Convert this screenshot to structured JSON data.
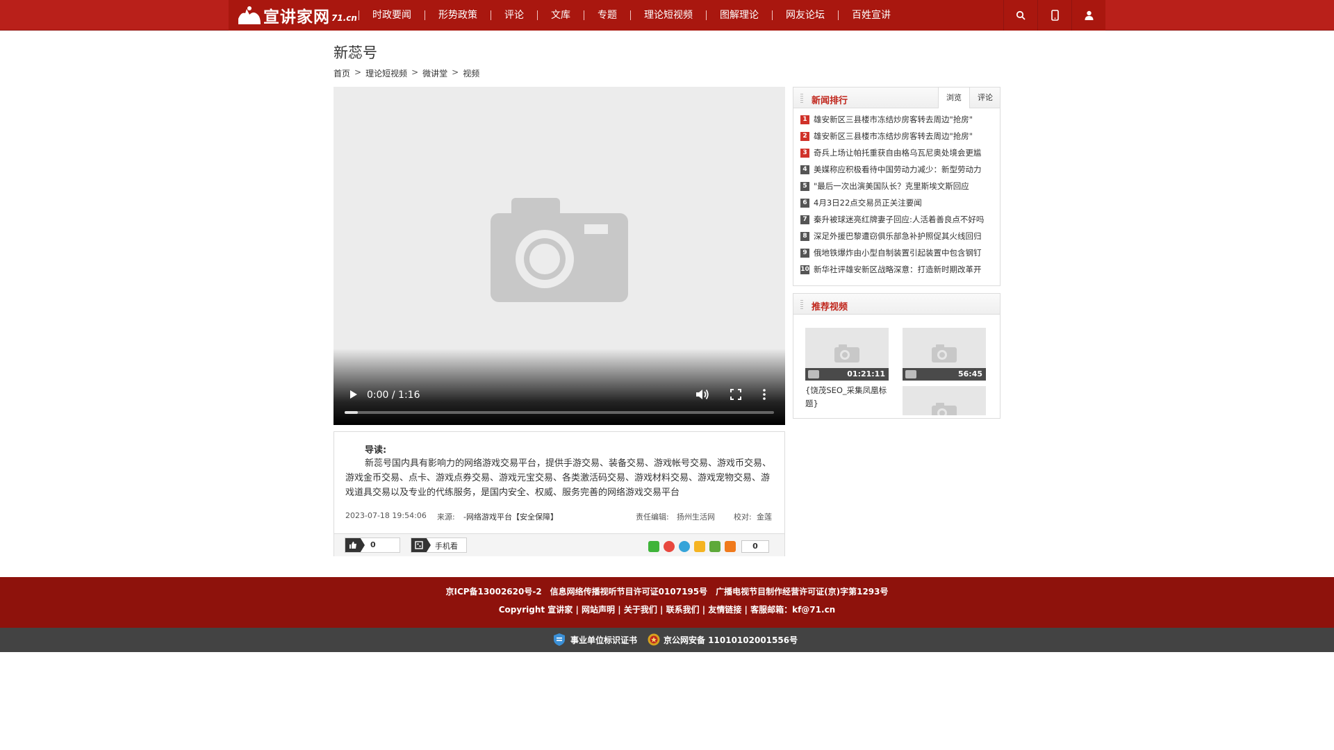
{
  "site": {
    "logo_text": "宣讲家网",
    "logo_sub": "71.cn",
    "nav": [
      "时政要闻",
      "形势政策",
      "评论",
      "文库",
      "专题",
      "理论短视频",
      "图解理论",
      "网友论坛",
      "百姓宣讲"
    ]
  },
  "page": {
    "title": "新蕊号",
    "breadcrumb": [
      "首页",
      "理论短视频",
      "微讲堂",
      "视频"
    ],
    "breadcrumb_sep": ">"
  },
  "video": {
    "time": "0:00 / 1:16",
    "progress": 0.03
  },
  "intro": {
    "label": "导读:",
    "body": "新蕊号国内具有影响力的网络游戏交易平台，提供手游交易、装备交易、游戏帐号交易、游戏币交易、游戏金币交易、点卡、游戏点券交易、游戏元宝交易、各类激活码交易、游戏材料交易、游戏宠物交易、游戏道具交易以及专业的代练服务，是国内安全、权威、服务完善的网络游戏交易平台",
    "date": "2023-07-18 19:54:06",
    "source_label": "来源:",
    "source": "-网络游戏平台【安全保障】",
    "editor_label": "责任编辑:",
    "editor": "扬州生活网",
    "proof_label": "校对:",
    "proof": "金莲"
  },
  "actions": {
    "like_count": "0",
    "mobile_label": "手机看",
    "share_count": "0"
  },
  "ranking": {
    "title": "新闻排行",
    "tabs": [
      "浏览",
      "评论"
    ],
    "items": [
      {
        "n": "1",
        "text": "雄安新区三县楼市冻结炒房客转去周边\"抢房\""
      },
      {
        "n": "2",
        "text": "雄安新区三县楼市冻结炒房客转去周边\"抢房\""
      },
      {
        "n": "3",
        "text": "奇兵上场让帕托重获自由格乌瓦尼奥处境会更尴"
      },
      {
        "n": "4",
        "text": "美媒称应积极看待中国劳动力减少：新型劳动力"
      },
      {
        "n": "5",
        "text": "\"最后一次出演美国队长？克里斯埃文斯回应"
      },
      {
        "n": "6",
        "text": "4月3日22点交易员正关注要闻"
      },
      {
        "n": "7",
        "text": "秦升被球迷亮红牌妻子回应:人活着善良点不好吗"
      },
      {
        "n": "8",
        "text": "深足外援巴黎遭窃俱乐部急补护照促其火线回归"
      },
      {
        "n": "9",
        "text": "俄地铁爆炸由小型自制装置引起装置中包含钢钉"
      },
      {
        "n": "10",
        "text": "新华社评雄安新区战略深意：打造新时期改革开"
      }
    ]
  },
  "recommend": {
    "title": "推荐视频",
    "videos": [
      {
        "duration": "01:21:11",
        "caption": "{饶茂SEO_采集凤凰标题}"
      },
      {
        "duration": "56:45",
        "caption": ""
      },
      {
        "duration": "",
        "caption": ""
      }
    ]
  },
  "footer": {
    "line1": "京ICP备13002620号-2　信息网络传播视听节目许可证0107195号　广播电视节目制作经营许可证(京)字第1293号",
    "copyright": "Copyright 宣讲家",
    "links": [
      "网站声明",
      "关于我们",
      "联系我们",
      "友情链接"
    ],
    "mail": "客服邮箱：kf@71.cn",
    "cert1": "事业单位标识证书",
    "cert2": "京公网安备 11010102001556号"
  },
  "colors": {
    "brand_red": "#b9201a",
    "footer_red": "#8e120c",
    "rank_hot": "#d0322a",
    "rank_cold": "#555555"
  }
}
